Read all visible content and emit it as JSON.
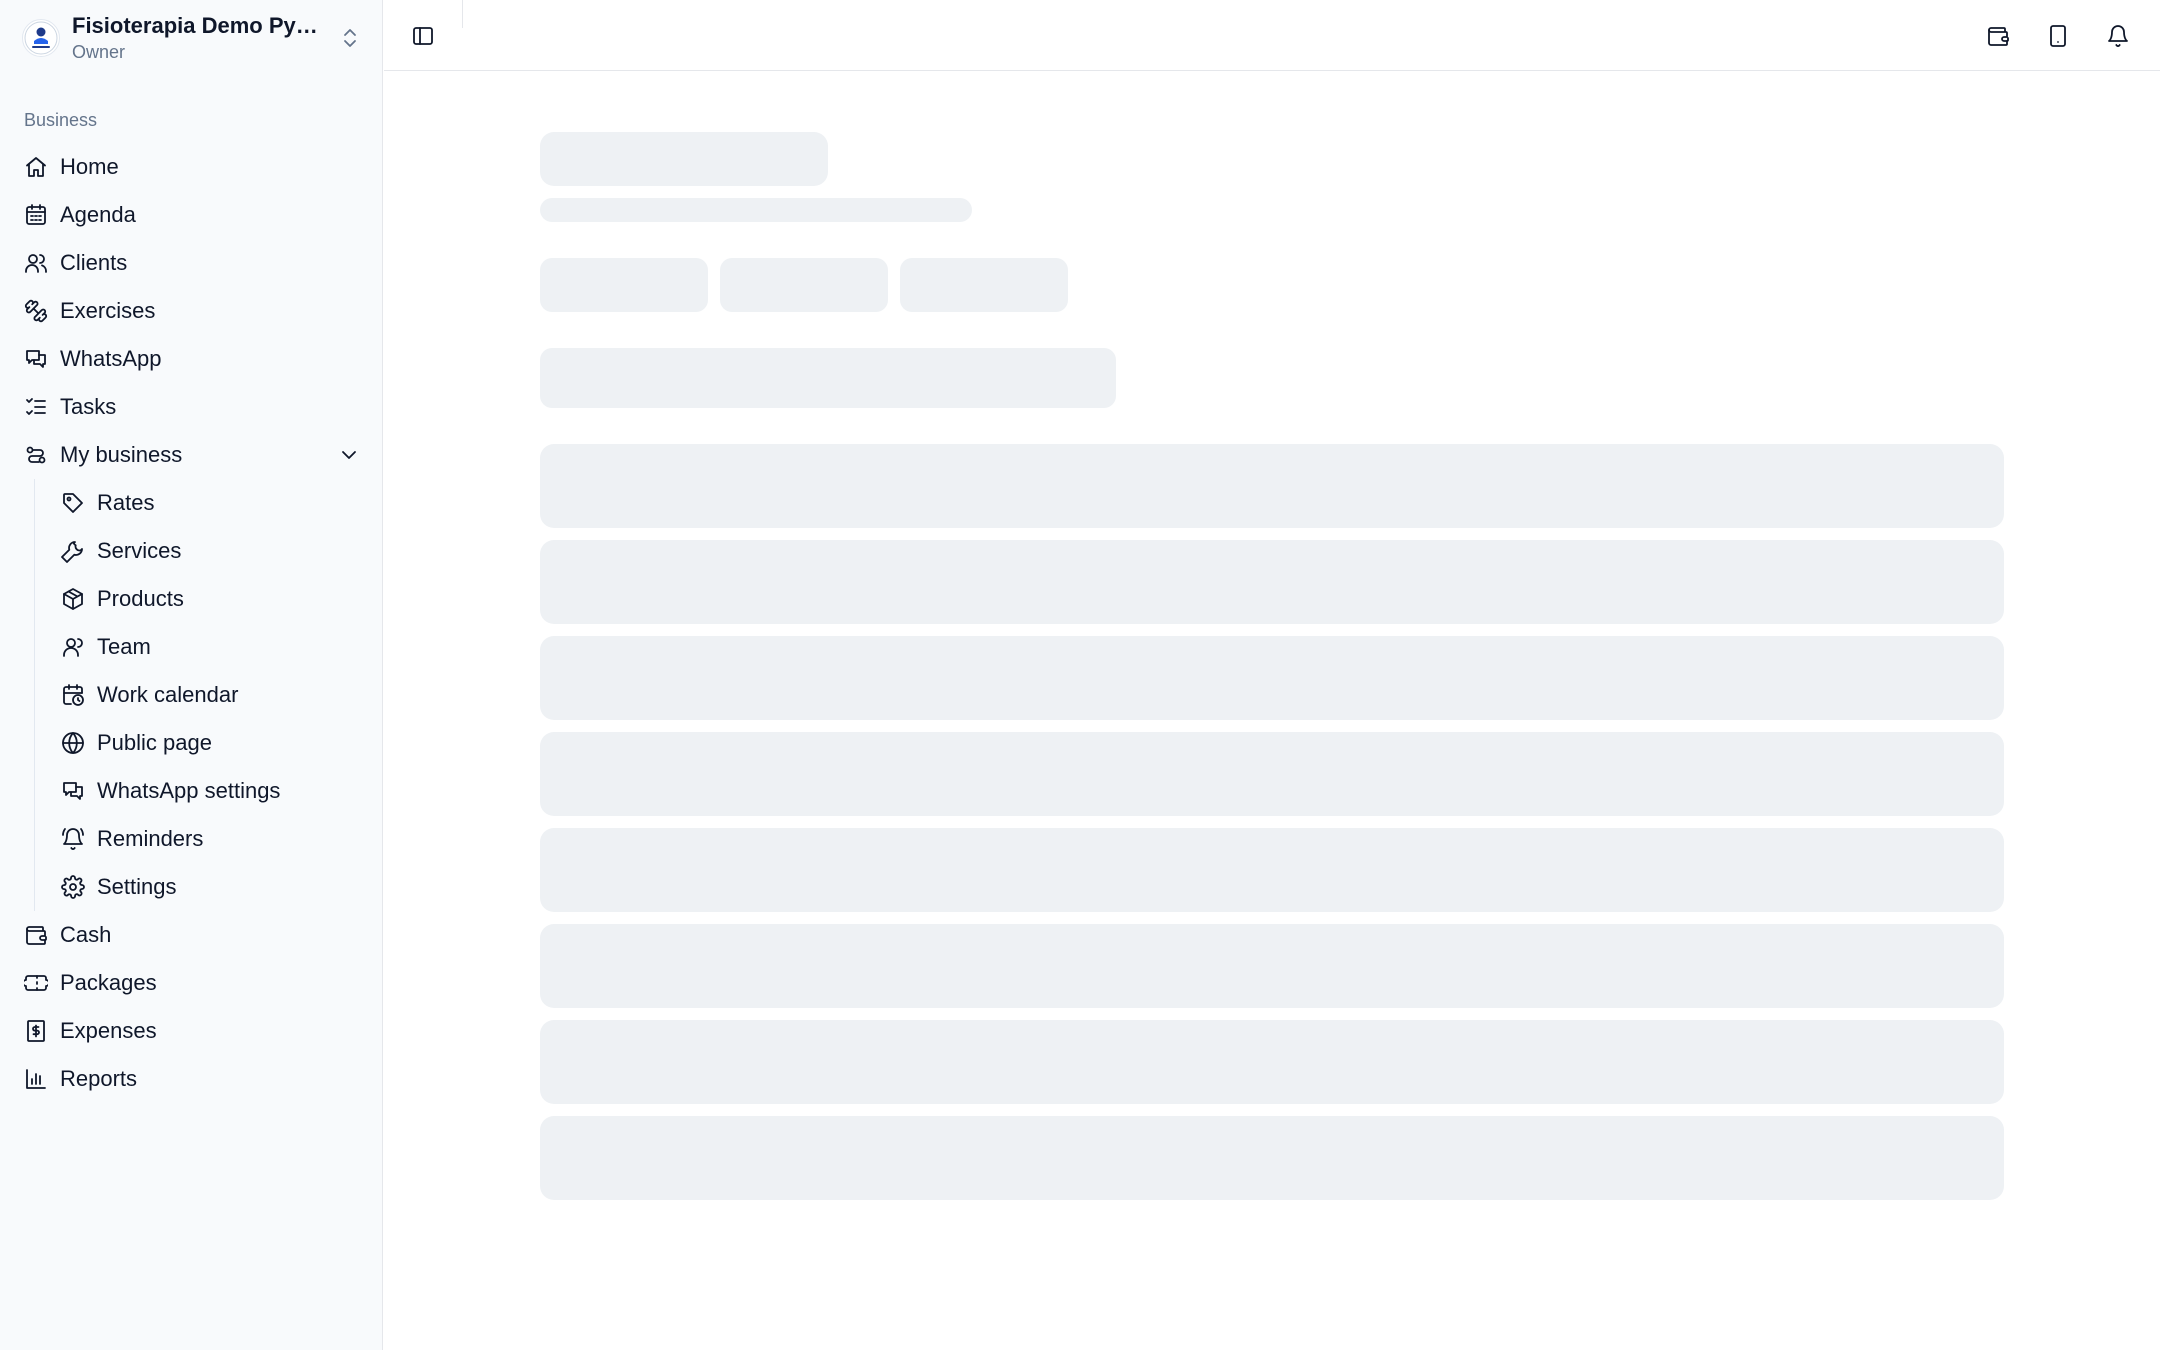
{
  "workspace": {
    "name": "Fisioterapia Demo Pym...",
    "role": "Owner",
    "avatar_icon": "clinic-logo-icon"
  },
  "sidebar": {
    "group_label": "Business",
    "items": [
      {
        "label": "Home",
        "icon": "home-icon"
      },
      {
        "label": "Agenda",
        "icon": "calendar-icon"
      },
      {
        "label": "Clients",
        "icon": "users-icon"
      },
      {
        "label": "Exercises",
        "icon": "dumbbell-icon"
      },
      {
        "label": "WhatsApp",
        "icon": "chat-icon"
      },
      {
        "label": "Tasks",
        "icon": "list-checks-icon"
      },
      {
        "label": "My business",
        "icon": "route-icon",
        "expanded": true
      }
    ],
    "sub_items": [
      {
        "label": "Rates",
        "icon": "tag-icon"
      },
      {
        "label": "Services",
        "icon": "wrench-icon"
      },
      {
        "label": "Products",
        "icon": "package-icon"
      },
      {
        "label": "Team",
        "icon": "user-icon"
      },
      {
        "label": "Work calendar",
        "icon": "calendar-clock-icon"
      },
      {
        "label": "Public page",
        "icon": "globe-icon"
      },
      {
        "label": "WhatsApp settings",
        "icon": "chat-icon"
      },
      {
        "label": "Reminders",
        "icon": "bell-ring-icon"
      },
      {
        "label": "Settings",
        "icon": "gear-icon"
      }
    ],
    "bottom_items": [
      {
        "label": "Cash",
        "icon": "wallet-icon"
      },
      {
        "label": "Packages",
        "icon": "ticket-icon"
      },
      {
        "label": "Expenses",
        "icon": "receipt-icon"
      },
      {
        "label": "Reports",
        "icon": "bar-chart-icon"
      }
    ]
  },
  "topbar": {
    "left_icon": "sidebar-toggle-icon",
    "right_icons": [
      "wallet-icon",
      "tablet-icon",
      "bell-icon"
    ]
  },
  "main": {
    "state": "loading-skeleton",
    "skeleton_color": "#eef1f4"
  }
}
